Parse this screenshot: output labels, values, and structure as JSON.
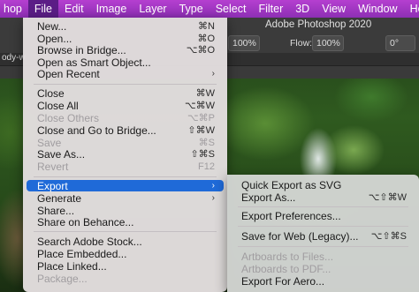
{
  "menubar": {
    "items": [
      "hop",
      "File",
      "Edit",
      "Image",
      "Layer",
      "Type",
      "Select",
      "Filter",
      "3D",
      "View",
      "Window",
      "Help"
    ]
  },
  "options": {
    "app_title": "Adobe Photoshop 2020",
    "opacity_value": "100%",
    "flow_label": "Flow:",
    "flow_value": "100%",
    "angle_value": "0°",
    "doc_tab": "ody-w"
  },
  "file_menu": {
    "items": [
      {
        "label": "New...",
        "shortcut": "⌘N"
      },
      {
        "label": "Open...",
        "shortcut": "⌘O"
      },
      {
        "label": "Browse in Bridge...",
        "shortcut": "⌥⌘O"
      },
      {
        "label": "Open as Smart Object..."
      },
      {
        "label": "Open Recent"
      },
      {
        "label": "Close",
        "shortcut": "⌘W"
      },
      {
        "label": "Close All",
        "shortcut": "⌥⌘W"
      },
      {
        "label": "Close Others",
        "shortcut": "⌥⌘P"
      },
      {
        "label": "Close and Go to Bridge...",
        "shortcut": "⇧⌘W"
      },
      {
        "label": "Save",
        "shortcut": "⌘S"
      },
      {
        "label": "Save As...",
        "shortcut": "⇧⌘S"
      },
      {
        "label": "Revert",
        "shortcut": "F12"
      },
      {
        "label": "Export"
      },
      {
        "label": "Generate"
      },
      {
        "label": "Share..."
      },
      {
        "label": "Share on Behance..."
      },
      {
        "label": "Search Adobe Stock..."
      },
      {
        "label": "Place Embedded..."
      },
      {
        "label": "Place Linked..."
      },
      {
        "label": "Package..."
      }
    ]
  },
  "export_submenu": {
    "items": [
      {
        "label": "Quick Export as SVG"
      },
      {
        "label": "Export As...",
        "shortcut": "⌥⇧⌘W"
      },
      {
        "label": "Export Preferences..."
      },
      {
        "label": "Save for Web (Legacy)...",
        "shortcut": "⌥⇧⌘S"
      },
      {
        "label": "Artboards to Files..."
      },
      {
        "label": "Artboards to PDF..."
      },
      {
        "label": "Export For Aero..."
      }
    ]
  },
  "colors": {
    "menubar": "#9b33c2",
    "selection": "#1f6ad8"
  }
}
